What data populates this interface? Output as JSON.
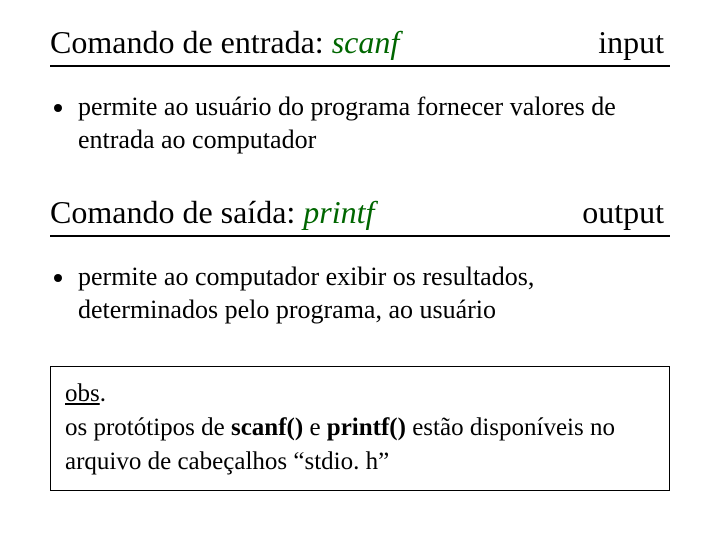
{
  "section1": {
    "heading_prefix": "Comando de entrada: ",
    "heading_keyword": "scanf",
    "heading_right": "input",
    "bullet": "permite ao usuário do programa fornecer valores de entrada ao computador"
  },
  "section2": {
    "heading_prefix": "Comando de saída: ",
    "heading_keyword": "printf",
    "heading_right": "output",
    "bullet": "permite ao computador exibir os resultados, determinados pelo programa, ao usuário"
  },
  "obs": {
    "label": "obs",
    "label_suffix": ".",
    "line_pre": "os protótipos de ",
    "scanf": "scanf()",
    "mid": " e ",
    "printf": "printf()",
    "line_post": " estão disponíveis no arquivo de cabeçalhos “stdio. h”"
  }
}
